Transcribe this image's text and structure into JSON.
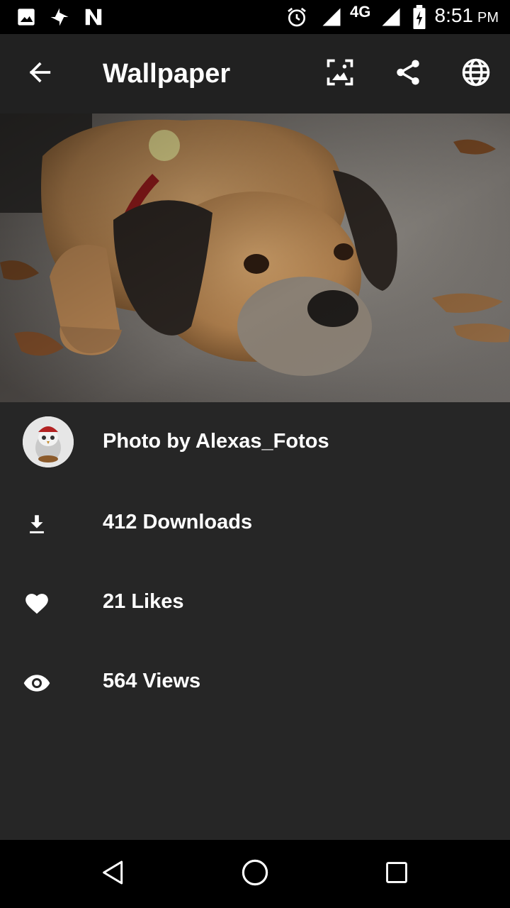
{
  "status_bar": {
    "time": "8:51",
    "ampm": "PM",
    "network": "4G",
    "icons": [
      "image-notification-icon",
      "pinwheel-notification-icon",
      "n-notification-icon",
      "alarm-icon",
      "signal-icon",
      "signal-icon-2",
      "battery-charging-icon"
    ]
  },
  "toolbar": {
    "title": "Wallpaper",
    "actions": [
      "back-arrow-icon",
      "set-wallpaper-icon",
      "share-icon",
      "globe-icon"
    ]
  },
  "photo": {
    "subject": "dog-lying-on-ground"
  },
  "details": {
    "author": "Photo by Alexas_Fotos",
    "downloads": "412 Downloads",
    "likes": "21 Likes",
    "views": "564 Views"
  },
  "colors": {
    "toolbar_bg": "#212121",
    "details_bg": "#262626",
    "system_bar_bg": "#000000",
    "text": "#ffffff"
  },
  "nav_bar": {
    "buttons": [
      "back-triangle-icon",
      "home-circle-icon",
      "recents-square-icon"
    ]
  }
}
